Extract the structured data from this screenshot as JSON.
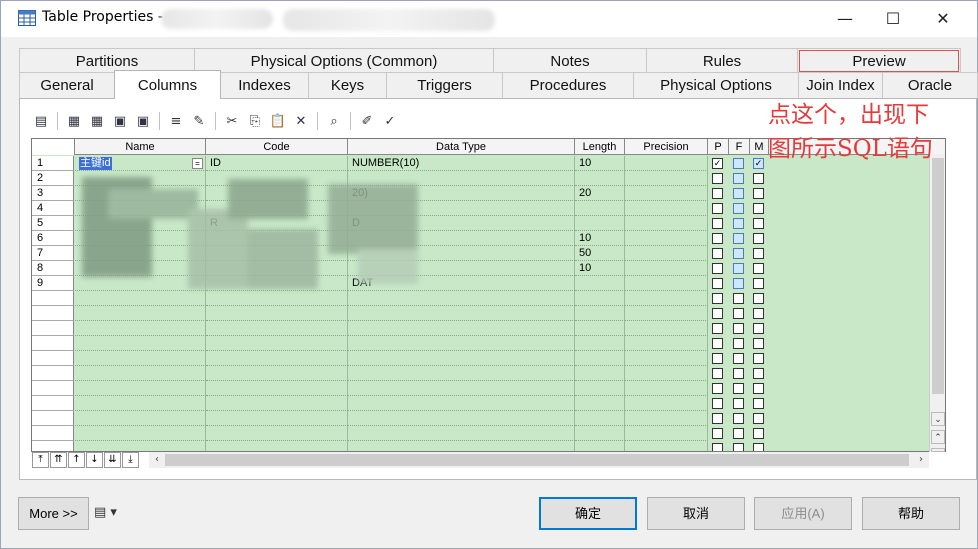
{
  "window": {
    "title": "Table Properties -",
    "controls": {
      "minimize": "—",
      "maximize": "☐",
      "close": "✕"
    }
  },
  "tabs_top": [
    {
      "label": "Physical Options (Common)"
    },
    {
      "label": "Notes"
    },
    {
      "label": "Rules"
    },
    {
      "label": "Preview"
    }
  ],
  "tabs_first": "Partitions",
  "tabs_bottom": [
    {
      "label": "General"
    },
    {
      "label": "Columns"
    },
    {
      "label": "Indexes"
    },
    {
      "label": "Keys"
    },
    {
      "label": "Triggers"
    },
    {
      "label": "Procedures"
    },
    {
      "label": "Physical Options"
    },
    {
      "label": "Join Index"
    },
    {
      "label": "Oracle"
    }
  ],
  "annotation": {
    "line1": "点这个，出现下",
    "line2": "图所示SQL语句"
  },
  "grid": {
    "headers": [
      "Name",
      "Code",
      "Data Type",
      "Length",
      "Precision",
      "P",
      "F",
      "M"
    ],
    "rows": [
      {
        "num": "1",
        "name": "主键id",
        "code": "ID",
        "type": "NUMBER(10)",
        "length": "10",
        "p": true,
        "m": true
      },
      {
        "num": "2",
        "name": "",
        "code": "",
        "type": "",
        "length": ""
      },
      {
        "num": "3",
        "name": "",
        "code": "",
        "type": "20)",
        "length": "20"
      },
      {
        "num": "4",
        "name": "",
        "code": "",
        "type": "",
        "length": ""
      },
      {
        "num": "5",
        "name": "",
        "code": "R",
        "type": "D",
        "length": ""
      },
      {
        "num": "6",
        "name": "",
        "code": "",
        "type": "",
        "length": "10"
      },
      {
        "num": "7",
        "name": "",
        "code": "",
        "type": "",
        "length": "50"
      },
      {
        "num": "8",
        "name": "",
        "code": "",
        "type": "",
        "length": "10"
      },
      {
        "num": "9",
        "name": "",
        "code": "",
        "type": "DAT",
        "length": ""
      }
    ],
    "empty_rows": 11
  },
  "footer": {
    "more": "More >>",
    "ok": "确定",
    "cancel": "取消",
    "apply": "应用(A)",
    "help": "帮助"
  }
}
